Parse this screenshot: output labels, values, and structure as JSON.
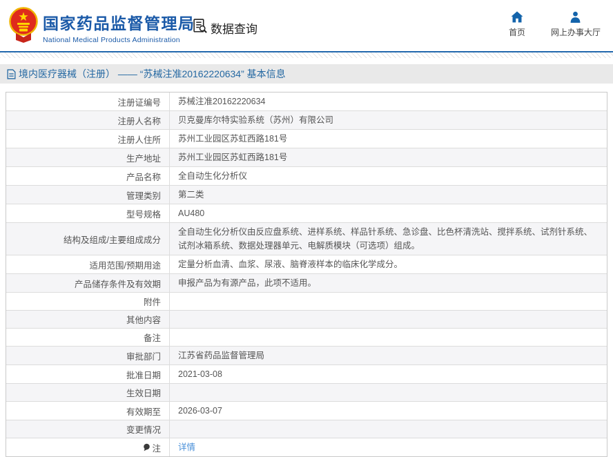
{
  "header": {
    "org_title": "国家药品监督管理局",
    "org_subtitle": "National Medical Products Administration",
    "section_label": "数据查询",
    "nav": [
      {
        "label": "首页"
      },
      {
        "label": "网上办事大厅"
      }
    ]
  },
  "breadcrumb": {
    "text": "境内医疗器械（注册） —— “苏械注准20162220634” 基本信息"
  },
  "table": {
    "rows": [
      {
        "label": "注册证编号",
        "value": "苏械注准20162220634"
      },
      {
        "label": "注册人名称",
        "value": "贝克曼库尔特实验系统（苏州）有限公司"
      },
      {
        "label": "注册人住所",
        "value": "苏州工业园区苏虹西路181号"
      },
      {
        "label": "生产地址",
        "value": "苏州工业园区苏虹西路181号"
      },
      {
        "label": "产品名称",
        "value": "全自动生化分析仪"
      },
      {
        "label": "管理类别",
        "value": "第二类"
      },
      {
        "label": "型号规格",
        "value": "AU480"
      },
      {
        "label": "结构及组成/主要组成成分",
        "value": "全自动生化分析仪由反应盘系统、进样系统、样品针系统、急诊盘、比色杯清洗站、搅拌系统、试剂针系统、试剂冰箱系统、数据处理器单元、电解质模块（可选项）组成。"
      },
      {
        "label": "适用范围/预期用途",
        "value": "定量分析血清、血浆、尿液、脑脊液样本的临床化学成分。"
      },
      {
        "label": "产品储存条件及有效期",
        "value": "申报产品为有源产品，此项不适用。"
      },
      {
        "label": "附件",
        "value": ""
      },
      {
        "label": "其他内容",
        "value": ""
      },
      {
        "label": "备注",
        "value": ""
      },
      {
        "label": "审批部门",
        "value": "江苏省药品监督管理局"
      },
      {
        "label": "批准日期",
        "value": "2021-03-08"
      },
      {
        "label": "生效日期",
        "value": ""
      },
      {
        "label": "有效期至",
        "value": "2026-03-07"
      },
      {
        "label": "变更情况",
        "value": ""
      },
      {
        "label": "注",
        "value": "详情"
      }
    ]
  },
  "icons": {
    "emblem": "national-emblem",
    "data_query": "document-search-icon",
    "home": "home-icon",
    "service_hall": "person-icon",
    "breadcrumb": "document-icon",
    "note": "note-pin-icon"
  },
  "colors": {
    "brand_blue": "#1b5aa8",
    "header_rule_blue": "#2268ad",
    "nav_icon_blue": "#1464ab",
    "breadcrumb_bg": "#e9e9e9",
    "breadcrumb_text": "#2468a2",
    "link_blue": "#4a90d9",
    "alt_row_bg": "#f5f5f7",
    "table_border": "#c9c9c9",
    "emblem_red": "#df2b1c",
    "emblem_gold": "#f0b400"
  }
}
